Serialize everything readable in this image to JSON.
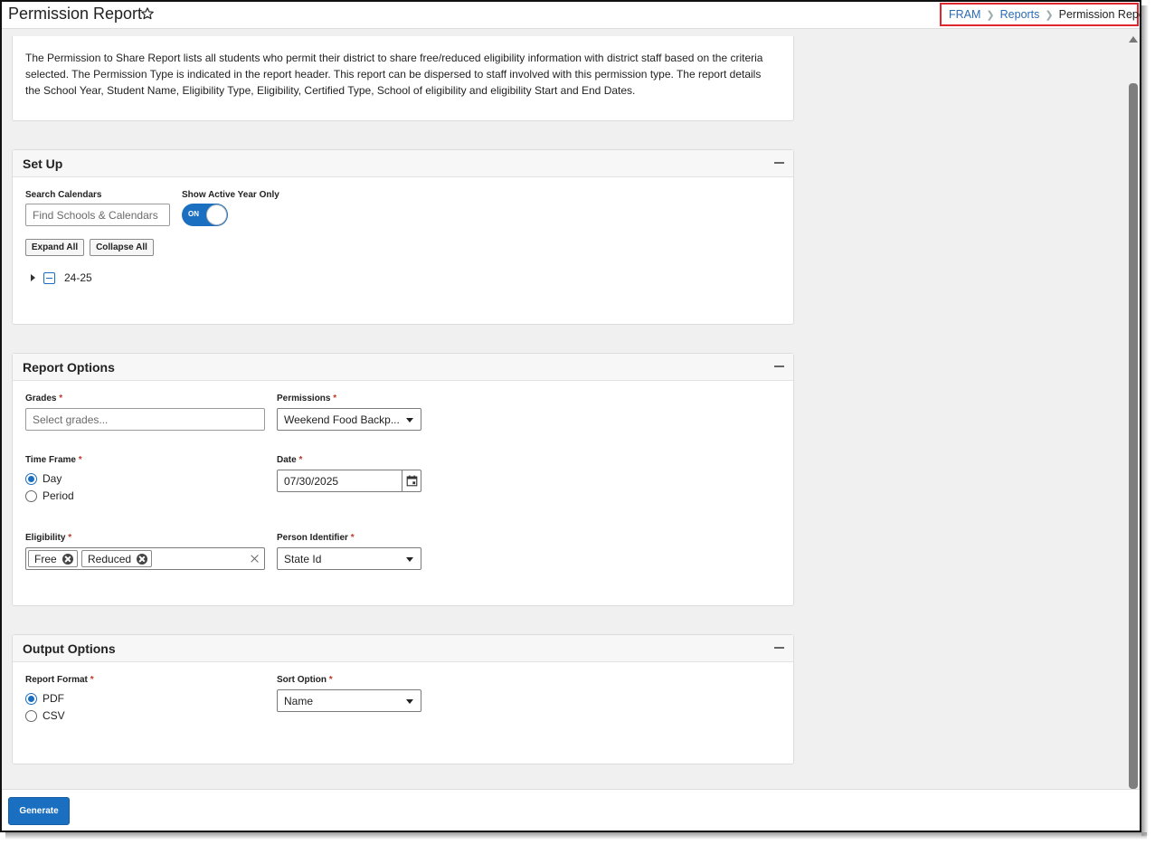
{
  "header": {
    "title": "Permission Report",
    "breadcrumb": {
      "crumb1": "FRAM",
      "crumb2": "Reports",
      "current": "Permission Report"
    }
  },
  "description": "The Permission to Share Report lists all students who permit their district to share free/reduced eligibility information with district staff based on the criteria selected. The Permission Type is indicated in the report header. This report can be dispersed to staff involved with this permission type. The report details the School Year, Student Name, Eligibility Type, Eligibility, Certified Type, School of eligibility and eligibility Start and End Dates.",
  "setup": {
    "title": "Set Up",
    "search_label": "Search Calendars",
    "search_placeholder": "Find Schools & Calendars",
    "active_year_label": "Show Active Year Only",
    "toggle_state": "ON",
    "expand_all": "Expand All",
    "collapse_all": "Collapse All",
    "tree_item": "24-25"
  },
  "report_options": {
    "title": "Report Options",
    "grades_label": "Grades",
    "grades_placeholder": "Select grades...",
    "permissions_label": "Permissions",
    "permissions_value": "Weekend Food Backp...",
    "timeframe_label": "Time Frame",
    "timeframe_options": {
      "day": "Day",
      "period": "Period"
    },
    "timeframe_selected": "Day",
    "date_label": "Date",
    "date_value": "07/30/2025",
    "eligibility_label": "Eligibility",
    "eligibility_chips": {
      "c1": "Free",
      "c2": "Reduced"
    },
    "person_identifier_label": "Person Identifier",
    "person_identifier_value": "State Id"
  },
  "output_options": {
    "title": "Output Options",
    "format_label": "Report Format",
    "format_options": {
      "pdf": "PDF",
      "csv": "CSV"
    },
    "format_selected": "PDF",
    "sort_label": "Sort Option",
    "sort_value": "Name"
  },
  "footer": {
    "generate_label": "Generate"
  },
  "required_marker": "*",
  "colors": {
    "accent": "#1b6fc0",
    "link": "#2a6bb5",
    "highlight_border": "#e0262f",
    "required": "#c0392b"
  }
}
